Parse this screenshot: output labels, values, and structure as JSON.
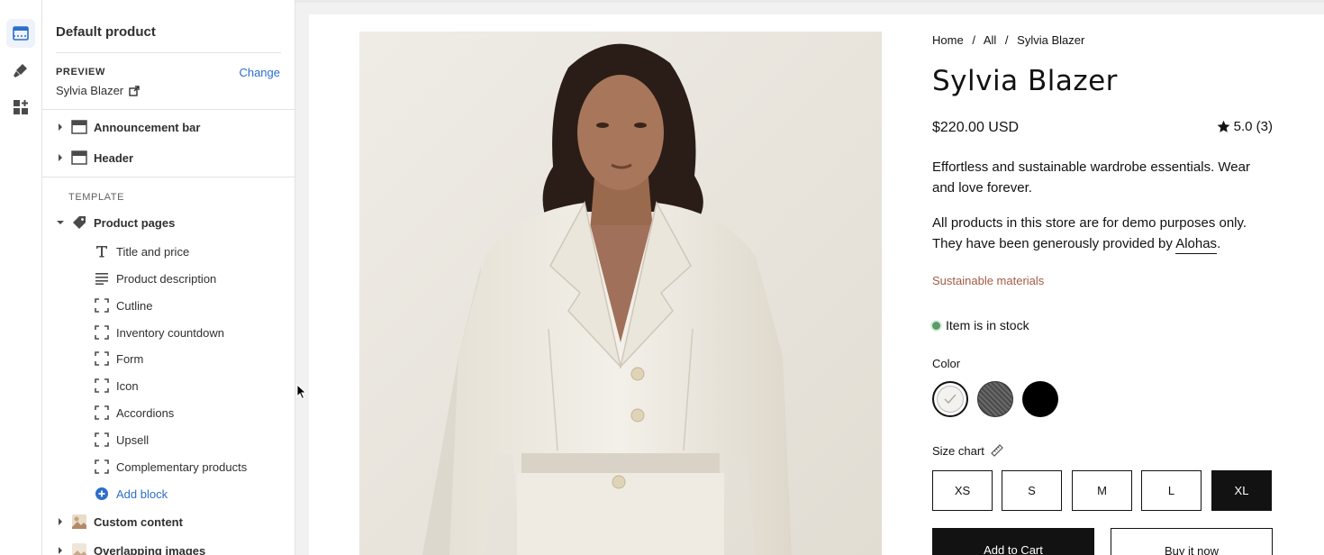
{
  "sidebar": {
    "title": "Default product",
    "preview_label": "PREVIEW",
    "change_label": "Change",
    "preview_value": "Sylvia Blazer",
    "sections": {
      "announcement": "Announcement bar",
      "header": "Header",
      "template_label": "TEMPLATE",
      "product_pages": "Product pages",
      "custom_content": "Custom content",
      "overlapping_images": "Overlapping images"
    },
    "blocks": [
      "Title and price",
      "Product description",
      "Cutline",
      "Inventory countdown",
      "Form",
      "Icon",
      "Accordions",
      "Upsell",
      "Complementary products"
    ],
    "add_block": "Add block"
  },
  "product": {
    "breadcrumb": [
      "Home",
      "/",
      "All",
      "/",
      "Sylvia Blazer"
    ],
    "title": "Sylvia Blazer",
    "price": "$220.00 USD",
    "rating": "5.0 (3)",
    "description": "Effortless and sustainable wardrobe essentials. Wear and love forever.",
    "disclaimer_prefix": "All products in this store are for demo purposes only. They have been generously provided by ",
    "disclaimer_link": "Alohas",
    "disclaimer_suffix": ".",
    "sustainable": "Sustainable materials",
    "stock": "Item is in stock",
    "color_label": "Color",
    "size_chart": "Size chart",
    "sizes": [
      "XS",
      "S",
      "M",
      "L",
      "XL"
    ],
    "selected_size": "XL",
    "add_to_cart": "Add to Cart",
    "buy_now": "Buy it now"
  },
  "colors": {
    "accent_blue": "#2c6ecb",
    "sustainable_text": "#a35b45",
    "stock_dot": "#5a9b6a",
    "button_dark": "#121212"
  }
}
